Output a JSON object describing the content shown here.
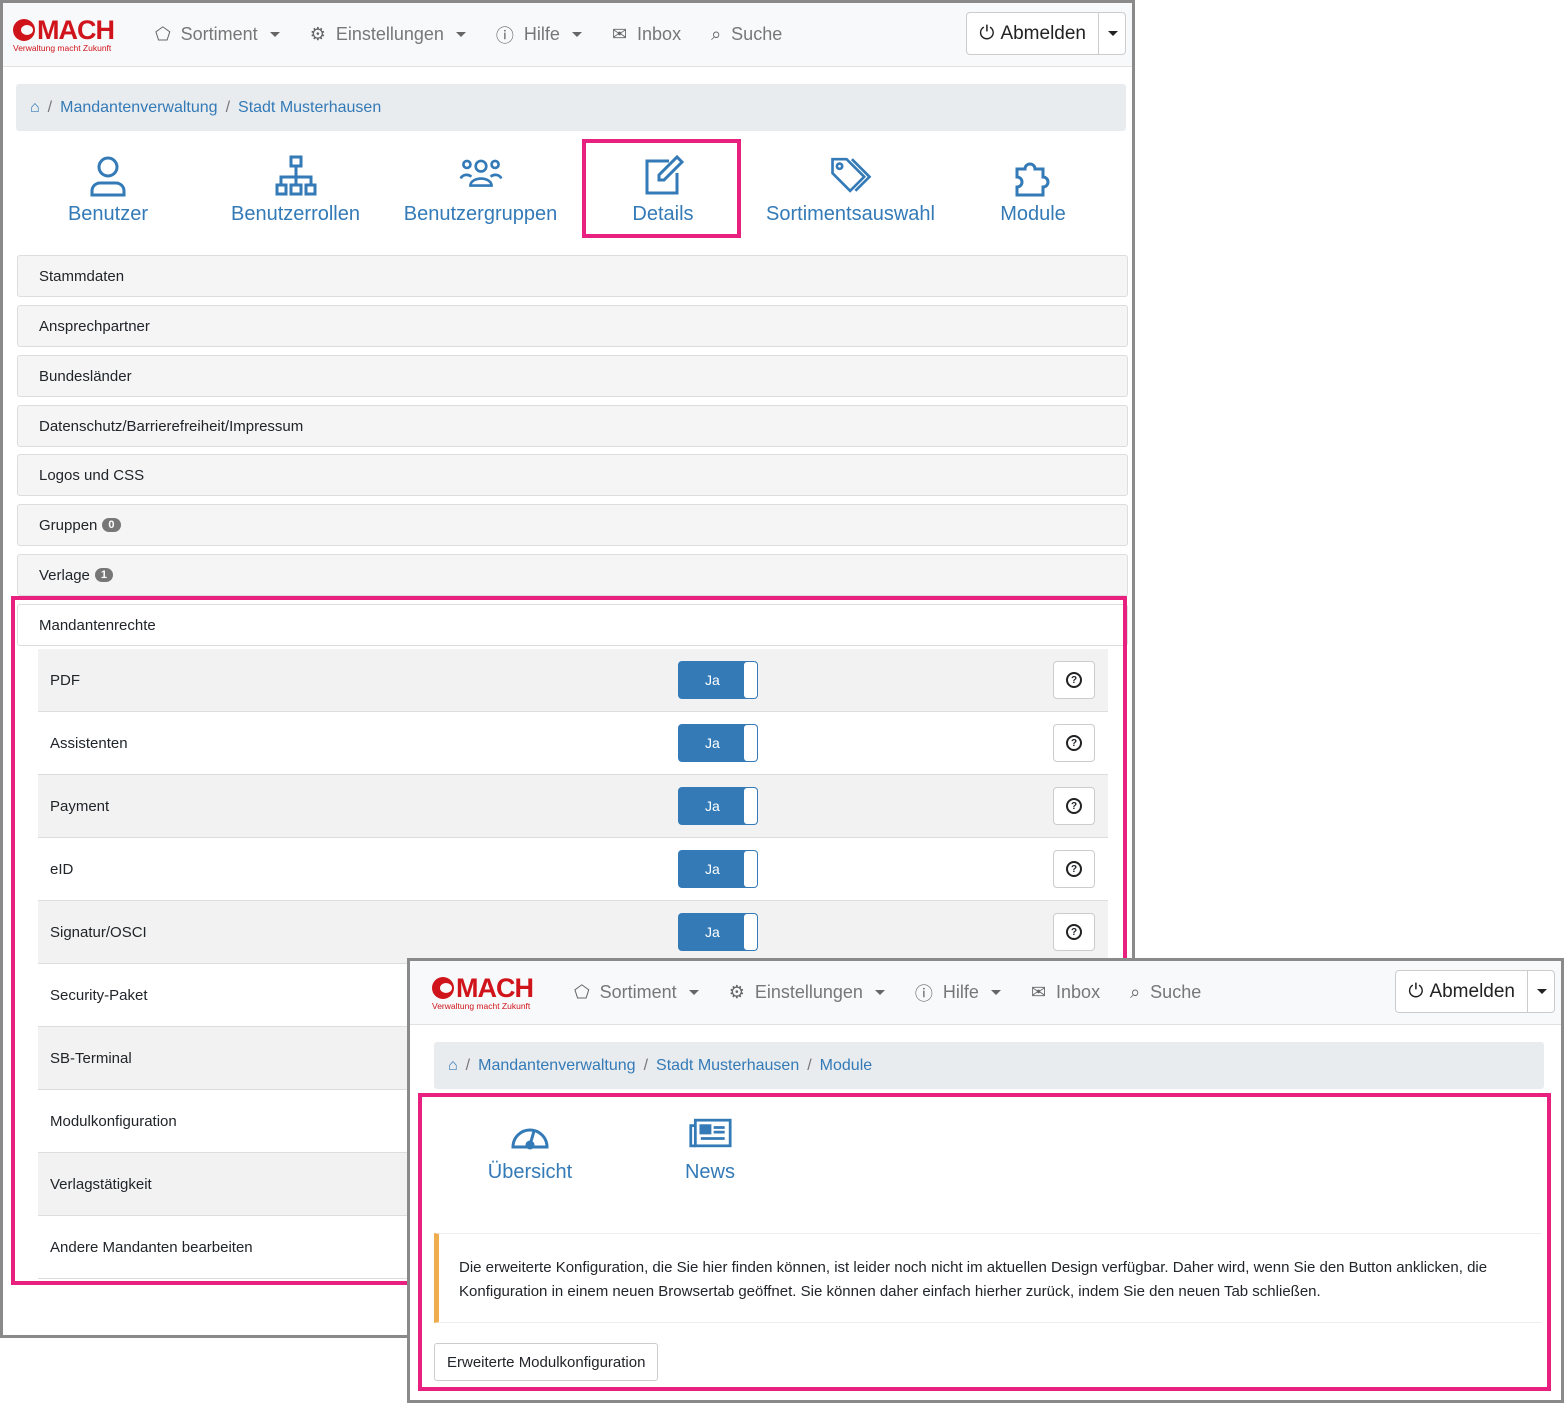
{
  "nav": {
    "logo": "MACH",
    "logo_tagline": "Verwaltung macht Zukunft",
    "items": [
      {
        "label": "Sortiment",
        "icon": "tag-icon",
        "dropdown": true
      },
      {
        "label": "Einstellungen",
        "icon": "gear-icon",
        "dropdown": true
      },
      {
        "label": "Hilfe",
        "icon": "question-circle-icon",
        "dropdown": true
      },
      {
        "label": "Inbox",
        "icon": "envelope-icon"
      },
      {
        "label": "Suche",
        "icon": "search-icon"
      }
    ],
    "logout": "Abmelden"
  },
  "window1": {
    "breadcrumb": [
      "Mandantenverwaltung",
      "Stadt Musterhausen"
    ],
    "tabs": [
      {
        "label": "Benutzer",
        "icon": "user-icon"
      },
      {
        "label": "Benutzerrollen",
        "icon": "sitemap-icon"
      },
      {
        "label": "Benutzergruppen",
        "icon": "users-icon"
      },
      {
        "label": "Details",
        "icon": "edit-icon"
      },
      {
        "label": "Sortimentsauswahl",
        "icon": "tags-icon"
      },
      {
        "label": "Module",
        "icon": "puzzle-icon"
      }
    ],
    "panels": [
      {
        "label": "Stammdaten"
      },
      {
        "label": "Ansprechpartner"
      },
      {
        "label": "Bundesländer"
      },
      {
        "label": "Datenschutz/Barrierefreiheit/Impressum"
      },
      {
        "label": "Logos und CSS"
      },
      {
        "label": "Gruppen",
        "badge": "0"
      },
      {
        "label": "Verlage",
        "badge": "1"
      }
    ],
    "rights_title": "Mandantenrechte",
    "rights": [
      {
        "label": "PDF",
        "toggle": "Ja"
      },
      {
        "label": "Assistenten",
        "toggle": "Ja"
      },
      {
        "label": "Payment",
        "toggle": "Ja"
      },
      {
        "label": "eID",
        "toggle": "Ja"
      },
      {
        "label": "Signatur/OSCI",
        "toggle": "Ja"
      },
      {
        "label": "Security-Paket"
      },
      {
        "label": "SB-Terminal"
      },
      {
        "label": "Modulkonfiguration"
      },
      {
        "label": "Verlagstätigkeit"
      },
      {
        "label": "Andere Mandanten bearbeiten"
      }
    ]
  },
  "window2": {
    "breadcrumb": [
      "Mandantenverwaltung",
      "Stadt Musterhausen",
      "Module"
    ],
    "tabs": [
      {
        "label": "Übersicht",
        "icon": "dashboard-icon"
      },
      {
        "label": "News",
        "icon": "newspaper-icon"
      }
    ],
    "alert": "Die erweiterte Konfiguration, die Sie hier finden können, ist leider noch nicht im aktuellen Design verfügbar. Daher wird, wenn Sie den Button anklicken, die Konfiguration in einem neuen Browsertab geöffnet. Sie können daher einfach hierher zurück, indem Sie den neuen Tab schließen.",
    "button": "Erweiterte Modulkonfiguration"
  },
  "colors": {
    "accent": "#337ab7",
    "highlight": "#e8207f",
    "brand": "#d0141b",
    "warning": "#f0ad4e"
  }
}
